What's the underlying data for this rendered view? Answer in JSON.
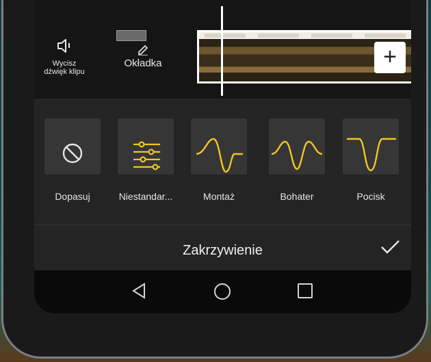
{
  "toolbar": {
    "mute_label": "Wycisz\ndźwięk klipu",
    "cover_label": "Okładka",
    "add_symbol": "+"
  },
  "presets": [
    {
      "label": "Dopasuj",
      "icon": "no-curve-icon"
    },
    {
      "label": "Niestandar...",
      "icon": "sliders-icon"
    },
    {
      "label": "Montaż",
      "icon": "montage-curve-icon"
    },
    {
      "label": "Bohater",
      "icon": "hero-curve-icon"
    },
    {
      "label": "Pocisk",
      "icon": "bullet-curve-icon"
    }
  ],
  "footer": {
    "title": "Zakrzywienie"
  },
  "colors": {
    "accent": "#f3c623",
    "panel": "#242424",
    "tile": "#363636"
  }
}
